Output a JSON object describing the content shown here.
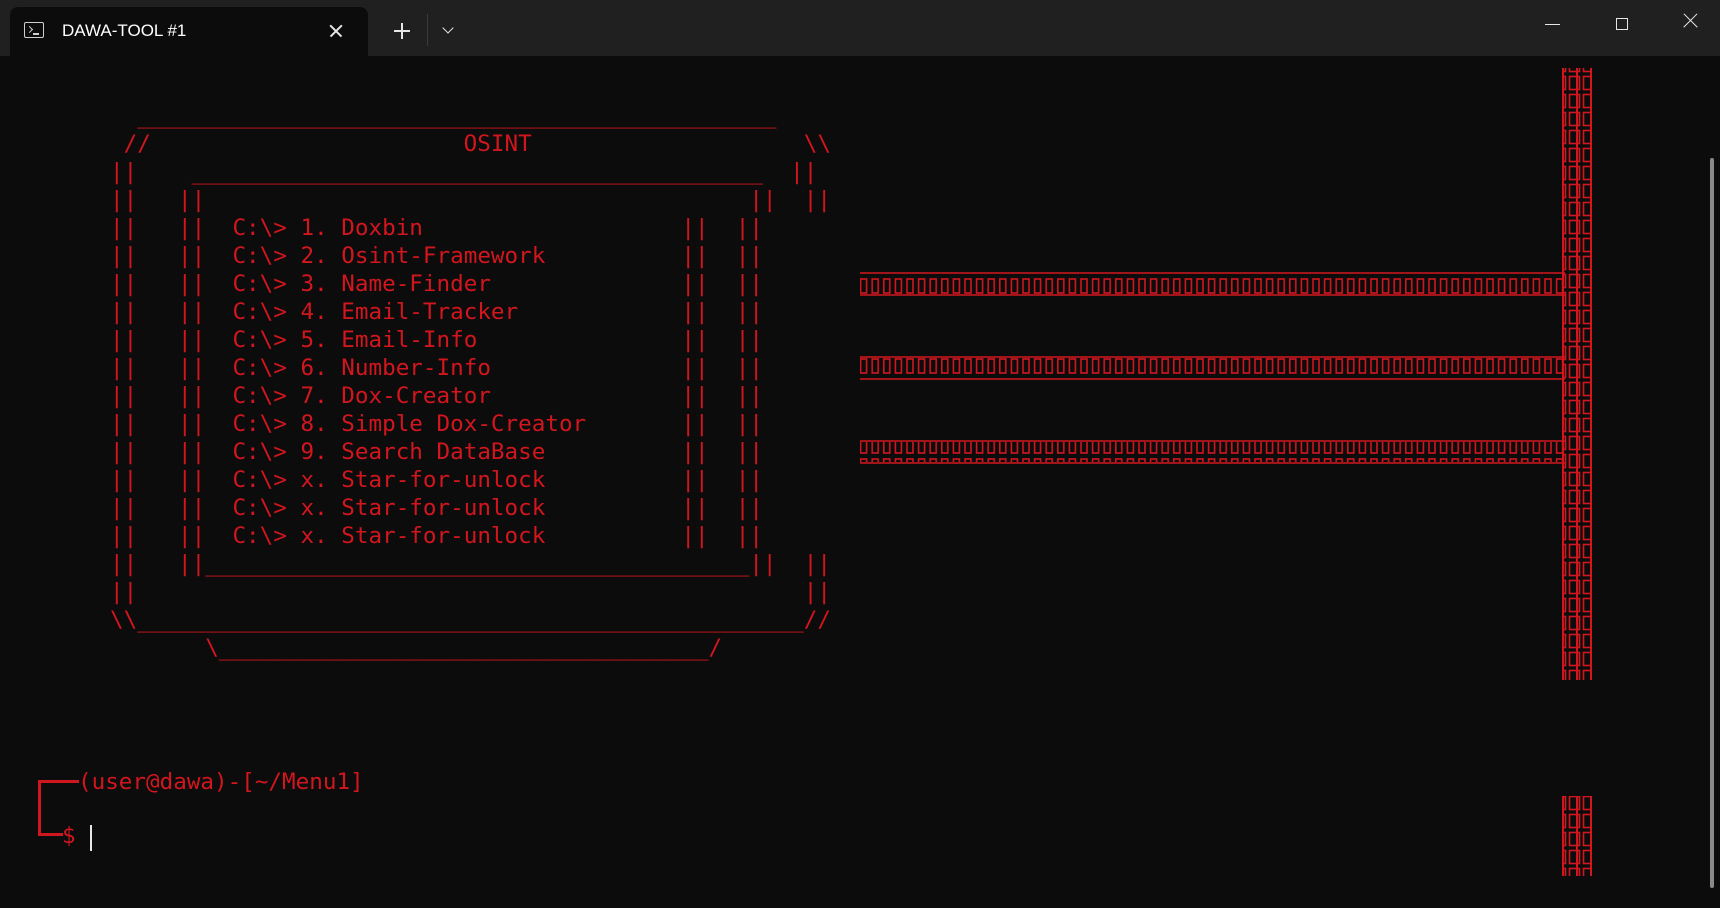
{
  "window": {
    "tab_title": "DAWA-TOOL #1",
    "tab_icon": "terminal-icon",
    "controls": [
      "minimize-icon",
      "maximize-icon",
      "close-icon"
    ]
  },
  "colors": {
    "background": "#0c0c0c",
    "titlebar": "#202020",
    "accent_red": "#d2161e",
    "text_white": "#ffffff"
  },
  "menu": {
    "frame_top": "  _______________________________________________ ",
    "title_line": " //                       OSINT                    \\\\",
    "inner_top": "||    __________________________________________  ||",
    "inner_blank": "||   ||                                        ||  ||",
    "inner_bottom": "||   ||________________________________________||  ||",
    "outer_blank": "||                                                 ||",
    "frame_bottom": "\\\\_________________________________________________//",
    "base": "       \\____________________________________/",
    "prefix": "C:\\>",
    "items": [
      {
        "key": "1.",
        "label": "Doxbin"
      },
      {
        "key": "2.",
        "label": "Osint-Framework"
      },
      {
        "key": "3.",
        "label": "Name-Finder"
      },
      {
        "key": "4.",
        "label": "Email-Tracker"
      },
      {
        "key": "5.",
        "label": "Email-Info"
      },
      {
        "key": "6.",
        "label": "Number-Info"
      },
      {
        "key": "7.",
        "label": "Dox-Creator"
      },
      {
        "key": "8.",
        "label": "Simple Dox-Creator"
      },
      {
        "key": "9.",
        "label": "Search DataBase"
      },
      {
        "key": "x.",
        "label": "Star-for-unlock"
      },
      {
        "key": "x.",
        "label": "Star-for-unlock"
      },
      {
        "key": "x.",
        "label": "Star-for-unlock"
      }
    ]
  },
  "prompt": {
    "context": "(user@dawa)-[~/Menu1]",
    "symbol": "$",
    "input_value": ""
  }
}
